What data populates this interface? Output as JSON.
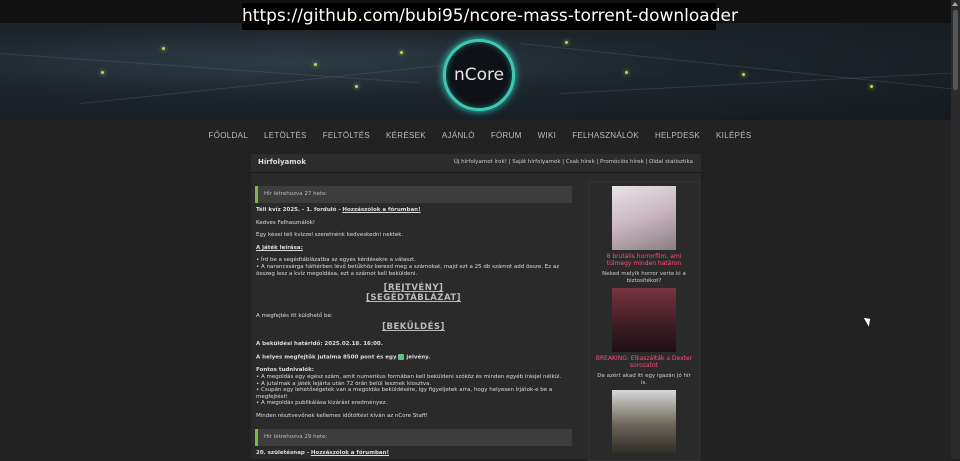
{
  "overlay": {
    "url": "https://github.com/bubi95/ncore-mass-torrent-downloader"
  },
  "logo": {
    "text": "nCore"
  },
  "nav": [
    "FŐOLDAL",
    "LETÖLTÉS",
    "FELTÖLTÉS",
    "KÉRÉSEK",
    "AJÁNLÓ",
    "FÓRUM",
    "WIKI",
    "FELHASZNÁLÓK",
    "HELPDESK",
    "KILÉPÉS"
  ],
  "panel": {
    "title": "Hírfolyamok",
    "links": "Új hírfolyamot írok! | Saját hírfolyamok | Csak hírek | Promóciós hírek | Oldal statisztika"
  },
  "news": [
    {
      "header": "Hír létrehozva 27 hete:",
      "title_prefix": "Téli kvíz 2025. - 1. forduló -",
      "title_link": "Hozzászólok a fórumban!",
      "greeting": "Kedves Felhasználók!",
      "intro": "Egy kései téli kvízzel szeretnénk kedveskedni nektek.",
      "rules_title": "A játék leírása:",
      "rule1": "• Írd be a segédtáblázatba az egyes kérdésekre a választ.",
      "rule2": "• A narancssárga háttérben lévő betűkhöz keresd meg a számokat, majd ezt a 25 db számot add össze. Ez az összeg lesz a kvíz megoldása, ezt a számot kell beküldeni.",
      "link_puzzle": "[REJTVÉNY]",
      "link_table": "[SEGÉDTÁBLÁZAT]",
      "submit_text": "A megfejtés itt küldhető be:",
      "link_submit": "[BEKÜLDÉS]",
      "deadline": "A beküldési határidő: 2025.02.18. 16:00.",
      "reward_prefix": "A helyes megfejtők jutalma 8500 pont és egy",
      "reward_suffix": "jelvény.",
      "notes_title": "Fontos tudnivalók:",
      "note1": "• A megoldás egy egész szám, amit numerikus formában kell beküldeni szóköz és minden egyéb írásjel nélkül.",
      "note2": "• A jutalmak a játék lejárta után 72 órán belül lesznek kiosztva.",
      "note3": "• Csupán egy lehetőségetek van a megoldás beküldésére, így figyeljetek arra, hogy helyesen írjátok-e be a megfejtést!",
      "note4": "• A megoldás publikálása kizárást eredményez.",
      "closing": "Minden résztvevőnek kellemes időtöltést kíván az nCore Staff!"
    },
    {
      "header": "Hír létrehozva 29 hete:",
      "title_prefix": "20. születésnap -",
      "title_link": "Hozzászólok a fórumban!"
    }
  ],
  "sidebar": [
    {
      "caption": "8 brutális horrorfilm, ami túlmegy minden határon",
      "sub": "Neked melyik horror verte ki a biztosítékot?",
      "image": "horror-face"
    },
    {
      "caption": "BREAKING: Elkaszálták a Dexter sorozatot",
      "sub": "De azért akad itt egy igazán jó hír is.",
      "image": "dexter-poster"
    },
    {
      "caption": "",
      "sub": "",
      "image": "game-character"
    }
  ],
  "colors": {
    "accent_green": "#7eb842",
    "sidebar_caption": "#ff4d7a",
    "logo_ring": "#3fc7b4"
  }
}
